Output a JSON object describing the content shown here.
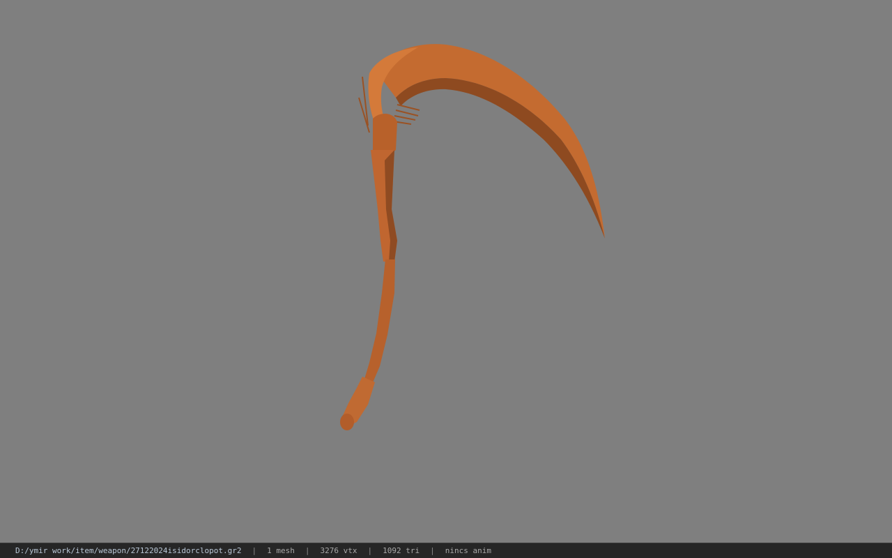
{
  "viewer": {
    "background_color": "#7f7f7f",
    "model_color": "#c0692f",
    "model_icon": "scythe-model"
  },
  "status_bar": {
    "file_path": "D:/ymir work/item/weapon/27122024isidorclopot.gr2",
    "separator": "|",
    "mesh_count": "1 mesh",
    "vertex_count": "3276 vtx",
    "triangle_count": "1092 tri",
    "animation": "nincs anim"
  }
}
